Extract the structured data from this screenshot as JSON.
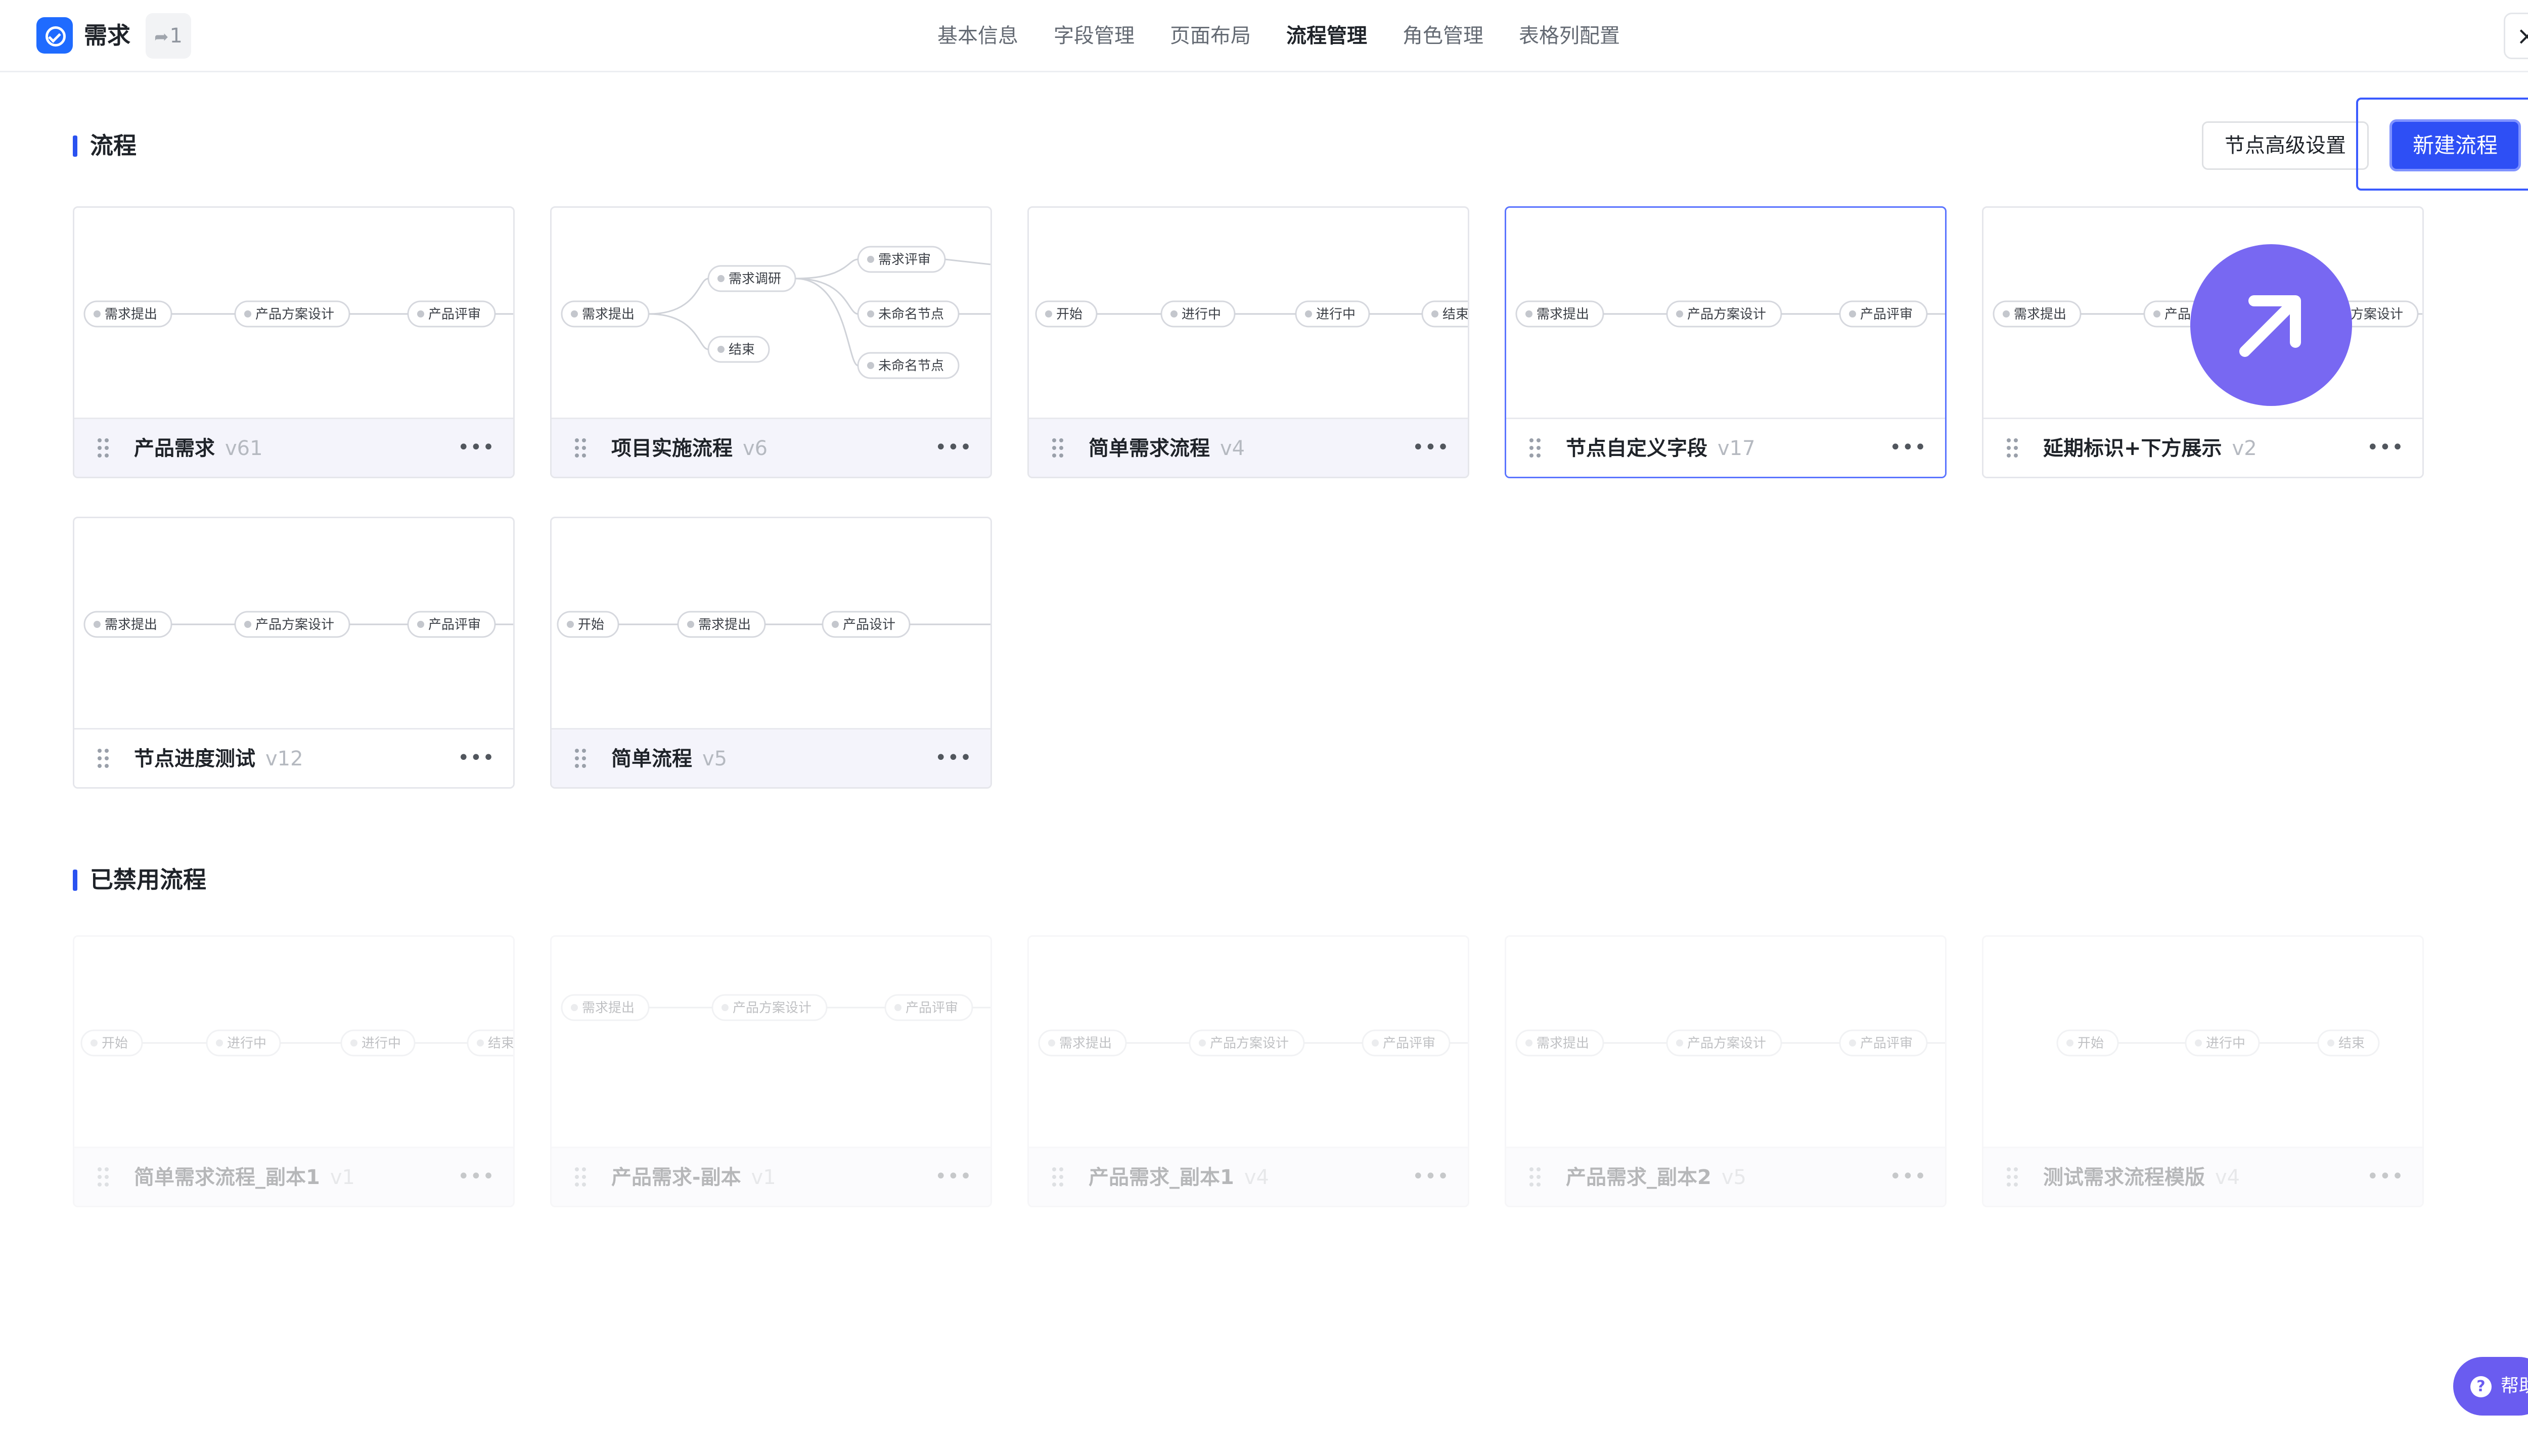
{
  "header": {
    "app_title": "需求",
    "share_count": "1",
    "tabs": [
      {
        "label": "基本信息"
      },
      {
        "label": "字段管理"
      },
      {
        "label": "页面布局"
      },
      {
        "label": "流程管理",
        "active": true
      },
      {
        "label": "角色管理"
      },
      {
        "label": "表格列配置"
      }
    ],
    "close_icon": "×"
  },
  "active_section": {
    "title": "流程",
    "advanced_button": "节点高级设置",
    "new_button": "新建流程",
    "flows": [
      {
        "name": "产品需求",
        "version": "v61",
        "nodes": [
          "需求提出",
          "产品方案设计",
          "产品评审"
        ]
      },
      {
        "name": "项目实施流程",
        "version": "v6",
        "nodes": [
          "需求提出",
          "需求调研",
          "结束",
          "需求评审",
          "未命名节点",
          "未命名节点"
        ]
      },
      {
        "name": "简单需求流程",
        "version": "v4",
        "nodes": [
          "开始",
          "进行中",
          "进行中",
          "结束"
        ]
      },
      {
        "name": "节点自定义字段",
        "version": "v17",
        "nodes": [
          "需求提出",
          "产品方案设计",
          "产品评审"
        ],
        "selected": true
      },
      {
        "name": "延期标识+下方展示",
        "version": "v2",
        "nodes": [
          "需求提出",
          "产品",
          "品方案设计"
        ]
      },
      {
        "name": "节点进度测试",
        "version": "v12",
        "nodes": [
          "需求提出",
          "产品方案设计",
          "产品评审"
        ]
      },
      {
        "name": "简单流程",
        "version": "v5",
        "nodes": [
          "开始",
          "需求提出",
          "产品设计"
        ]
      }
    ]
  },
  "disabled_section": {
    "title": "已禁用流程",
    "flows": [
      {
        "name": "简单需求流程_副本1",
        "version": "v1",
        "nodes": [
          "开始",
          "进行中",
          "进行中",
          "结束"
        ]
      },
      {
        "name": "产品需求-副本",
        "version": "v1",
        "nodes": [
          "需求提出",
          "产品方案设计",
          "产品评审"
        ]
      },
      {
        "name": "产品需求_副本1",
        "version": "v4",
        "nodes": [
          "需求提出",
          "产品方案设计",
          "产品评审"
        ]
      },
      {
        "name": "产品需求_副本2",
        "version": "v5",
        "nodes": [
          "需求提出",
          "产品方案设计",
          "产品评审"
        ]
      },
      {
        "name": "测试需求流程模版",
        "version": "v4",
        "nodes": [
          "开始",
          "进行中",
          "结束"
        ]
      }
    ]
  },
  "icons": {
    "app_logo": "check-circle-icon",
    "share": "share-arrow-icon",
    "drag": "drag-handle-icon",
    "more": "more-dots-icon",
    "overlay": "arrow-up-right-icon",
    "help": "help-circle-icon"
  },
  "more_label": "•••",
  "help_label": "帮助",
  "colors": {
    "accent": "#2e4ff5",
    "overlay": "#7868f2",
    "help": "#6a5cf0"
  }
}
